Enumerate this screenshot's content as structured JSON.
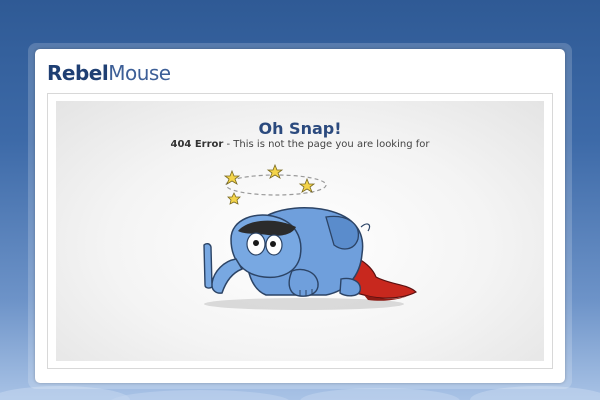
{
  "header": {
    "logo_part1": "Rebel",
    "logo_part2": "Mouse"
  },
  "error": {
    "title": "Oh Snap!",
    "code": "404 Error",
    "message": " - This is not the page you are looking for"
  },
  "colors": {
    "brand_dark": "#1f3f73",
    "brand_light": "#3d5f97",
    "title": "#2b4a7e",
    "elephant": "#6f9fdc",
    "cape": "#c8281e",
    "star": "#f4d44a"
  },
  "icons": {
    "illustration": "dizzy-elephant-illustration"
  }
}
